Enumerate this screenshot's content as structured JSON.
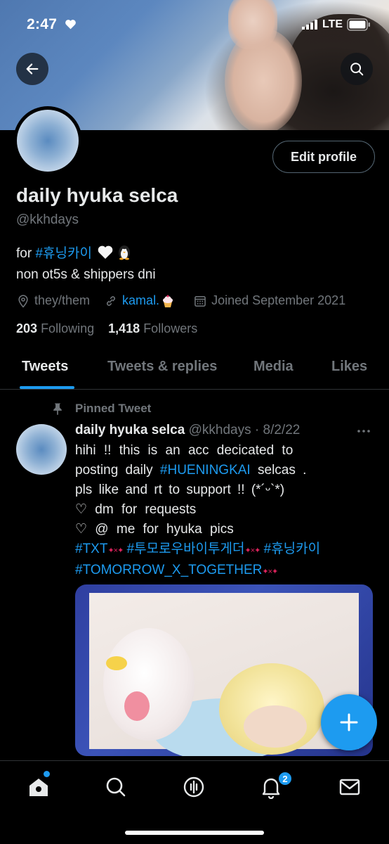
{
  "status_bar": {
    "time": "2:47",
    "network": "LTE"
  },
  "profile": {
    "display_name": "daily hyuka selca",
    "handle": "@kkhdays",
    "edit_button": "Edit profile",
    "bio": {
      "line1_prefix": "for ",
      "line1_hashtag": "#휴닝카이",
      "line2": "non ot5s & shippers dni"
    },
    "meta": {
      "pronouns": "they/them",
      "link": "kamal.",
      "joined": "Joined September 2021"
    },
    "following_count": "203",
    "following_label": "Following",
    "followers_count": "1,418",
    "followers_label": "Followers"
  },
  "tabs": [
    "Tweets",
    "Tweets & replies",
    "Media",
    "Likes"
  ],
  "active_tab": "Tweets",
  "pinned_tweet": {
    "pinned_label": "Pinned Tweet",
    "author_name": "daily hyuka selca",
    "author_handle": "@kkhdays",
    "date": "· 8/2/22",
    "lines": [
      "hihi !! this is an acc decicated to",
      "posting daily",
      "selcas .",
      "pls like and rt to support !! (*´ᵕ`*)",
      "♡ dm for requests",
      "♡ @ me for hyuka pics"
    ],
    "hashtag_inline": "#HUENINGKAI",
    "hashtags": [
      "#TXT",
      "#투모로우바이투게더",
      "#휴닝카이",
      "#TOMORROW_X_TOGETHER"
    ],
    "sparkle": "✦×✦"
  },
  "bottom_nav": {
    "items": [
      "home-icon",
      "search-icon",
      "spaces-icon",
      "notifications-icon",
      "messages-icon"
    ],
    "notification_count": "2"
  },
  "colors": {
    "accent": "#1d9bf0",
    "muted": "#71767b",
    "text": "#e7e9ea",
    "background": "#000000"
  }
}
